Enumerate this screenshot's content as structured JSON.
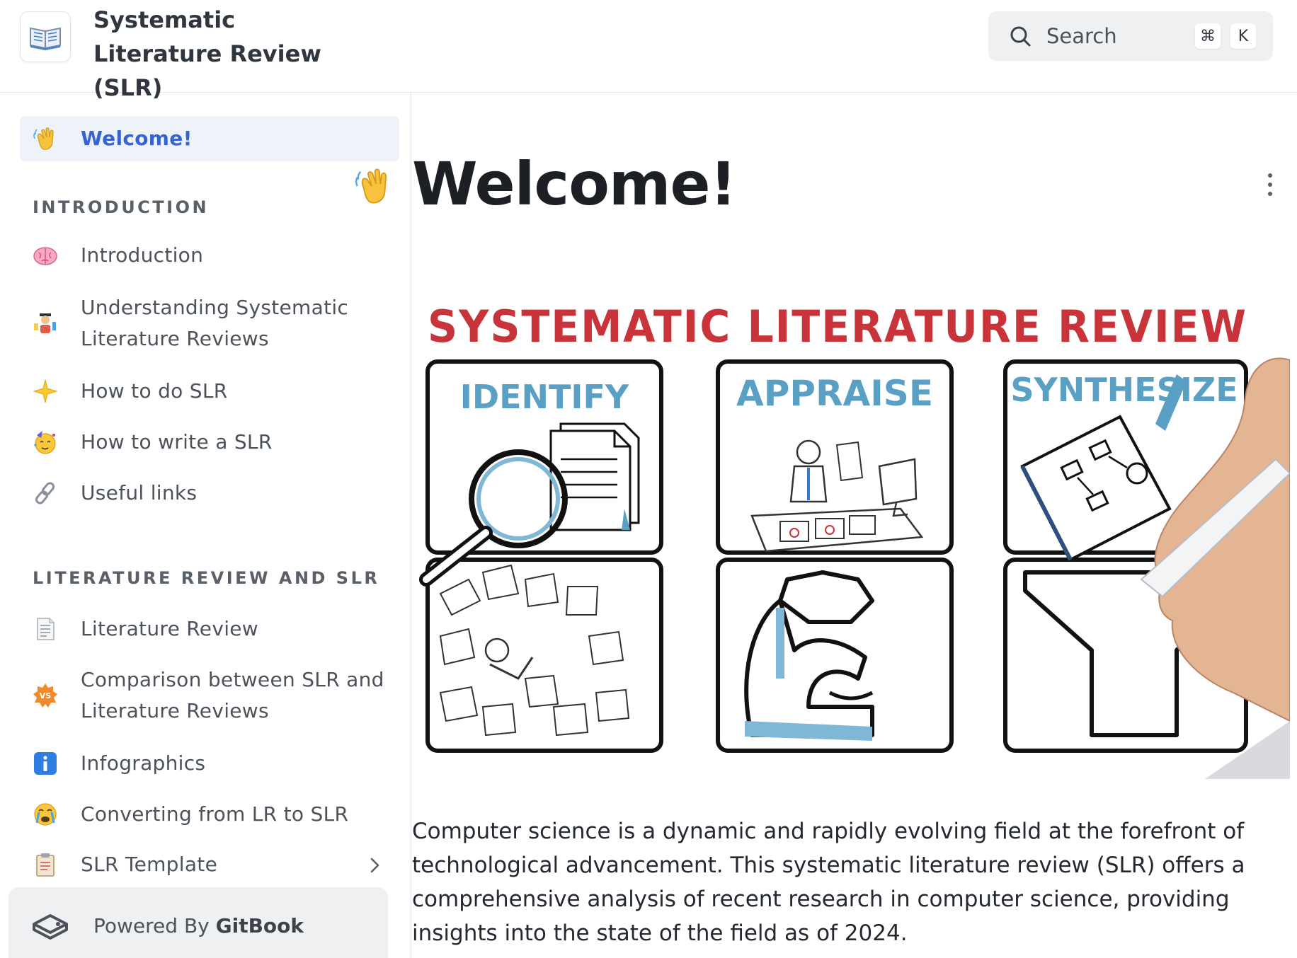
{
  "header": {
    "site_title": "Systematic Literature Review (SLR)",
    "search": {
      "label": "Search",
      "shortcut_mod": "⌘",
      "shortcut_key": "K"
    }
  },
  "sidebar": {
    "active": {
      "label": "Welcome!",
      "icon": "waving-hand-icon"
    },
    "sections": [
      {
        "title": "INTRODUCTION",
        "items": [
          {
            "label": "Introduction",
            "icon": "brain-icon"
          },
          {
            "label": "Understanding Systematic Literature Reviews",
            "icon": "student-icon"
          },
          {
            "label": "How to do SLR",
            "icon": "star-icon"
          },
          {
            "label": "How to write a SLR",
            "icon": "party-face-icon"
          },
          {
            "label": "Useful links",
            "icon": "link-icon"
          }
        ]
      },
      {
        "title": "LITERATURE REVIEW AND SLR",
        "items": [
          {
            "label": "Literature Review",
            "icon": "page-icon"
          },
          {
            "label": "Comparison between SLR and Literature Reviews",
            "icon": "vs-icon"
          },
          {
            "label": "Infographics",
            "icon": "info-icon"
          },
          {
            "label": "Converting from LR to SLR",
            "icon": "crying-face-icon"
          },
          {
            "label": "SLR Template",
            "icon": "clipboard-icon"
          }
        ]
      }
    ],
    "footer": {
      "prefix": "Powered By ",
      "brand": "GitBook"
    }
  },
  "main": {
    "title": "Welcome!",
    "banner": {
      "heading": "SYSTEMATIC LITERATURE REVIEW",
      "panels": [
        "IDENTIFY",
        "APPRAISE",
        "SYNTHESIZE"
      ]
    },
    "intro": "Computer science is a dynamic and rapidly evolving field at the forefront of technological advancement. This systematic literature review (SLR) offers a comprehensive analysis of recent research in computer science, providing insights into the state of the field as of 2024."
  },
  "colors": {
    "accent": "#3564d1",
    "banner_red": "#c8343a",
    "banner_blue": "#5a9fc4"
  }
}
